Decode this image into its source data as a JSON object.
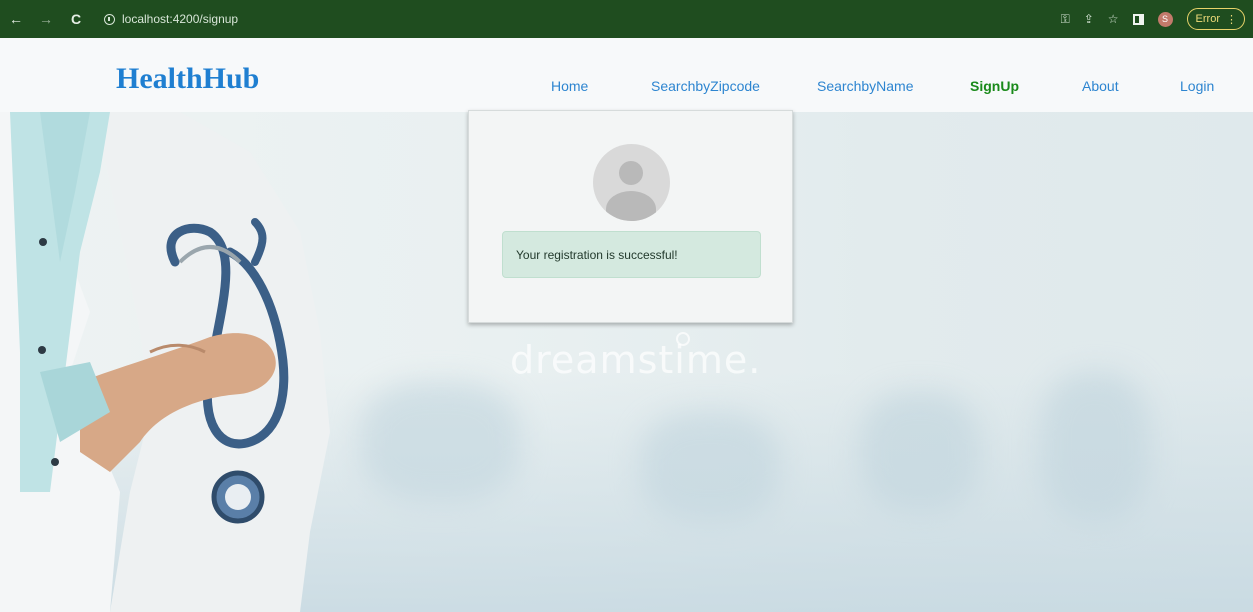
{
  "browser": {
    "url": "localhost:4200/signup",
    "profile_initial": "S",
    "error_label": "Error"
  },
  "navbar": {
    "brand": "HealthHub",
    "links": [
      {
        "label": "Home"
      },
      {
        "label": "SearchbyZipcode"
      },
      {
        "label": "SearchbyName"
      },
      {
        "label": "SignUp",
        "active": true
      },
      {
        "label": "About"
      },
      {
        "label": "Login"
      }
    ]
  },
  "card": {
    "message": "Your registration is successful!"
  },
  "background": {
    "watermark": "dreamstime."
  },
  "colors": {
    "chrome": "#1f4d1f",
    "brand": "#1f7fd1",
    "link": "#2d85d0",
    "active_link": "#1a8a1a",
    "alert_bg": "#d4e9df"
  },
  "icons": [
    "back-arrow-icon",
    "forward-arrow-icon",
    "reload-icon",
    "info-icon",
    "key-icon",
    "share-icon",
    "star-icon",
    "sidepanel-icon",
    "kebab-menu-icon",
    "avatar-placeholder-icon"
  ]
}
